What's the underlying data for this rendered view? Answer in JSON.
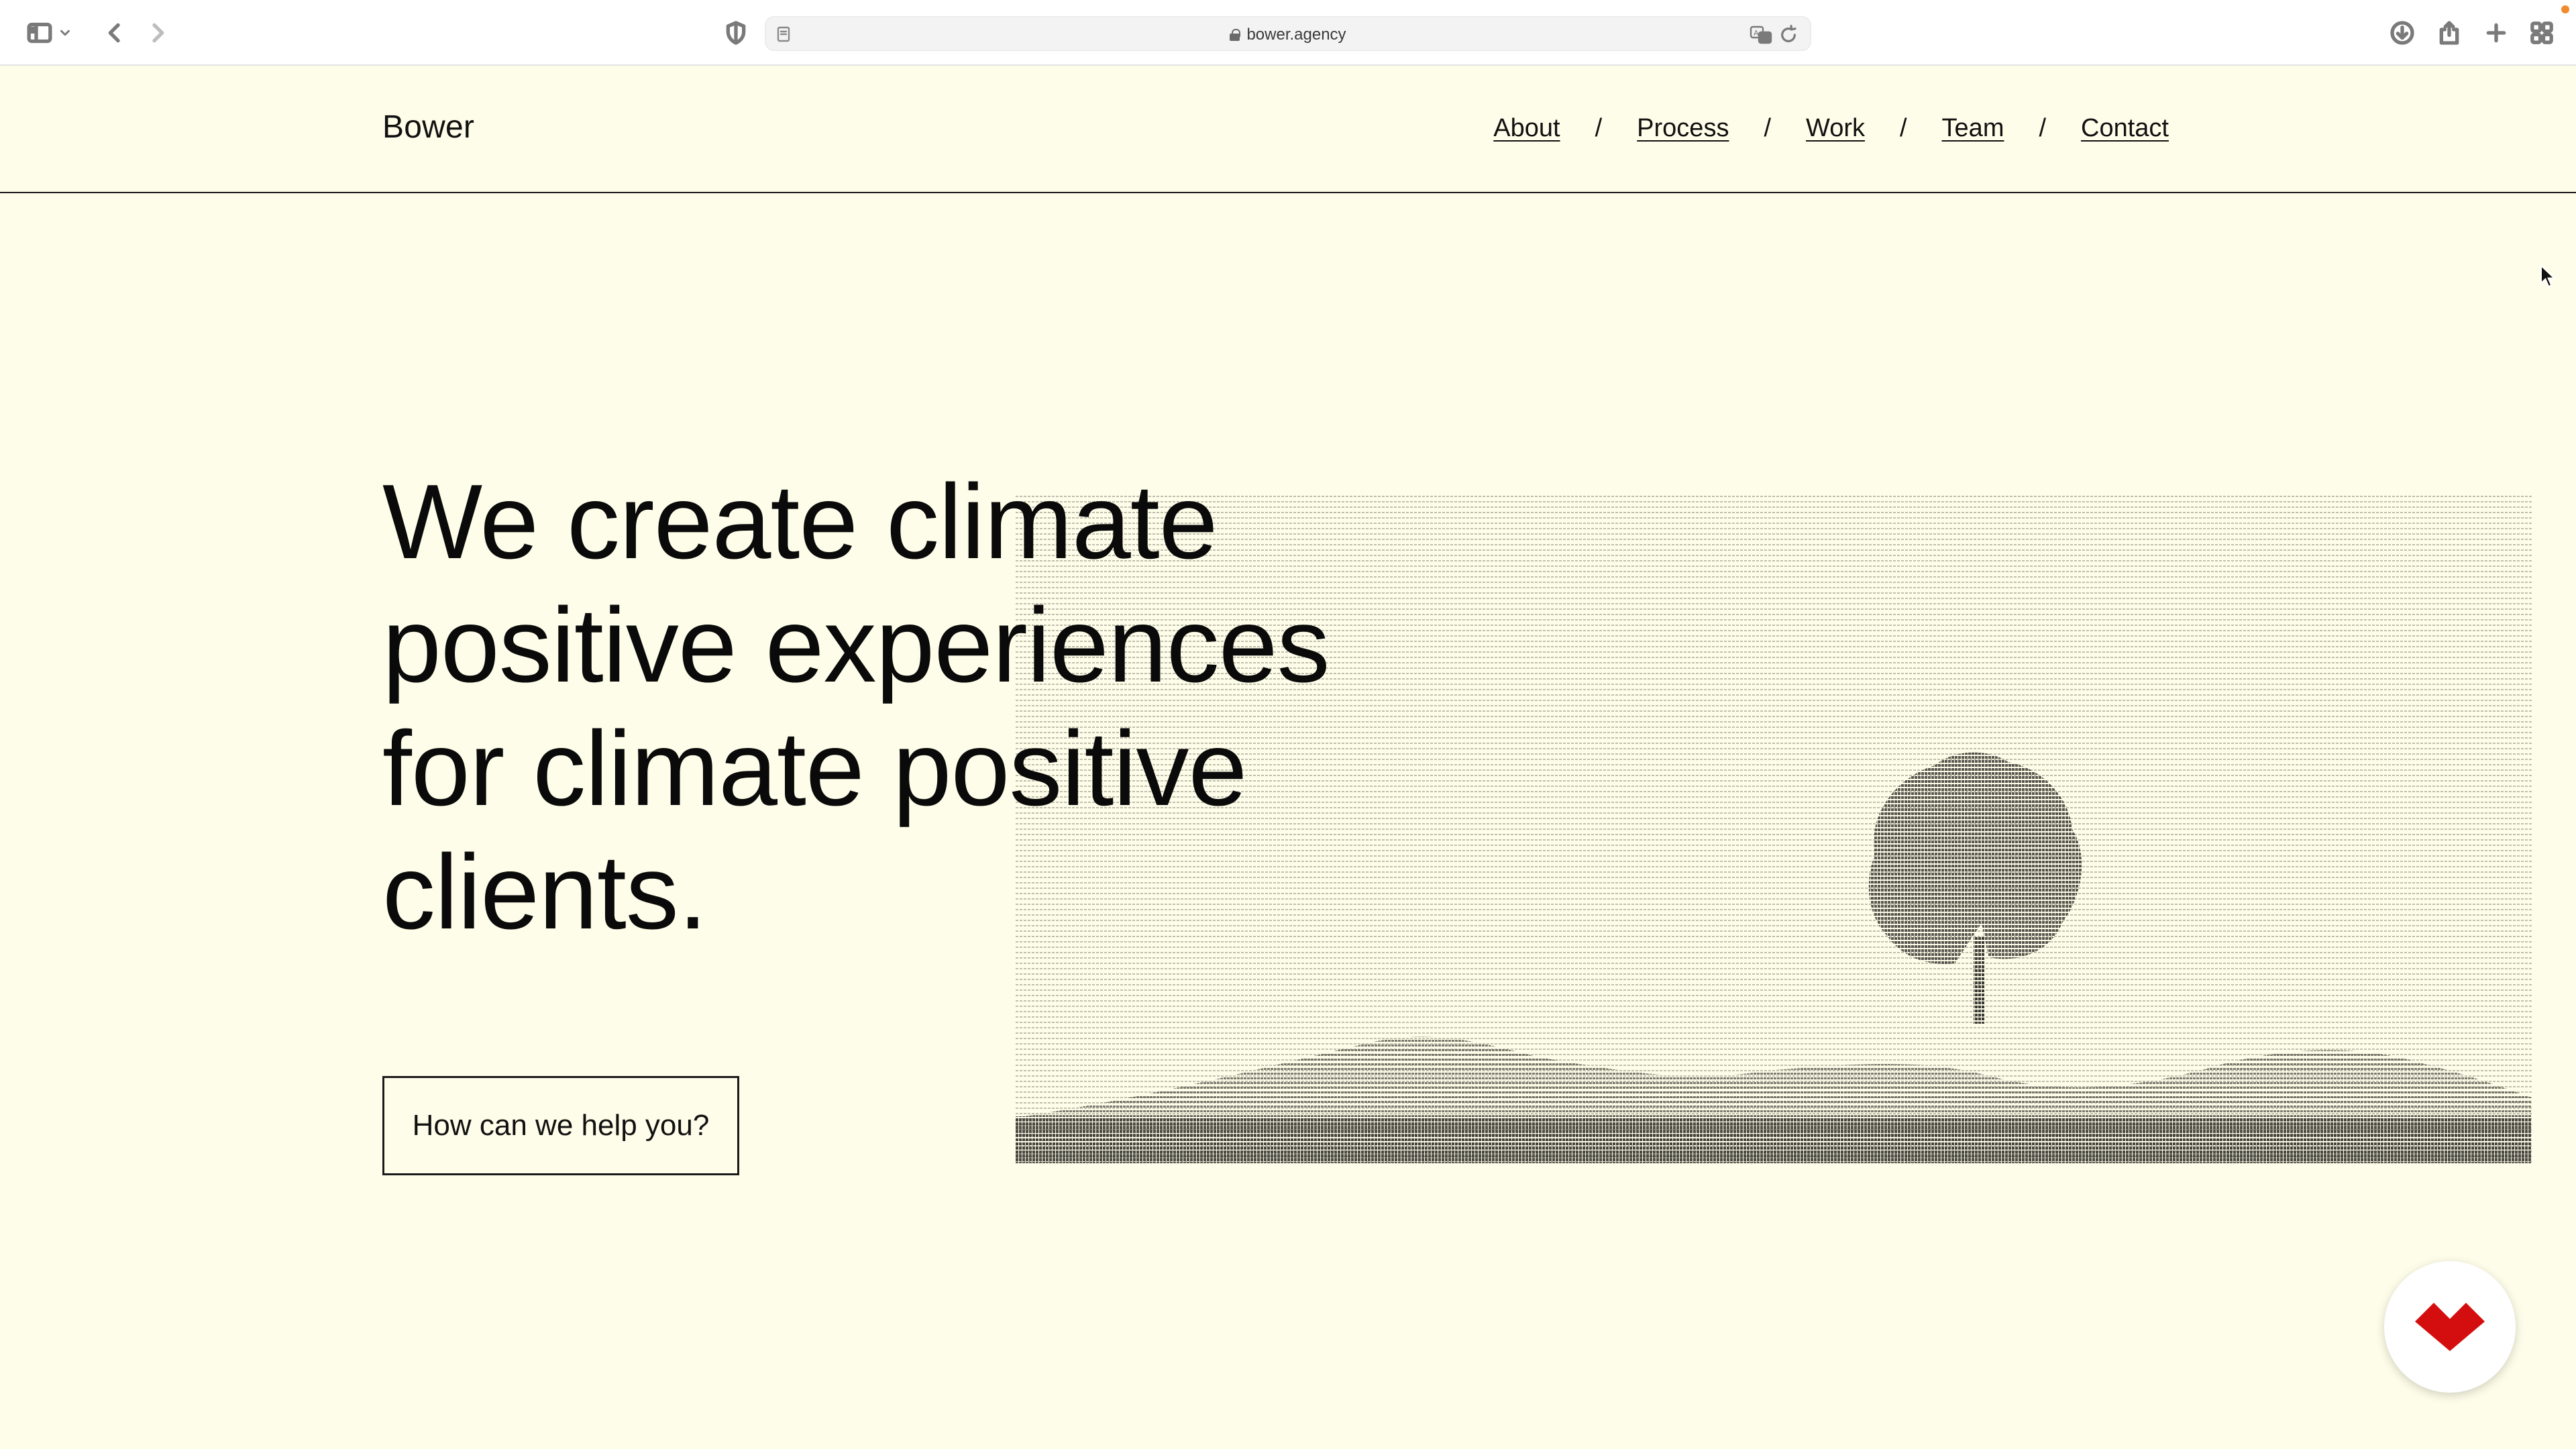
{
  "browser": {
    "url": "bower.agency",
    "icons": [
      "sidebar-icon",
      "chevron-down-icon",
      "back-icon",
      "forward-icon",
      "shield-icon",
      "page-icon",
      "lock-icon",
      "translate-icon",
      "reload-icon",
      "download-icon",
      "share-icon",
      "plus-icon",
      "tab-overview-icon"
    ]
  },
  "site": {
    "brand": "Bower",
    "nav": [
      {
        "label": "About"
      },
      {
        "label": "Process"
      },
      {
        "label": "Work"
      },
      {
        "label": "Team"
      },
      {
        "label": "Contact"
      }
    ],
    "nav_separator": "/"
  },
  "hero": {
    "title_lines": [
      "We create climate",
      "positive experiences",
      "for climate positive",
      "clients."
    ],
    "cta_label": "How can we help you?"
  },
  "colors": {
    "background": "#fefde9",
    "text": "#0d0d0d",
    "chat_accent": "#d40e0e",
    "notification": "#f08a2e"
  }
}
